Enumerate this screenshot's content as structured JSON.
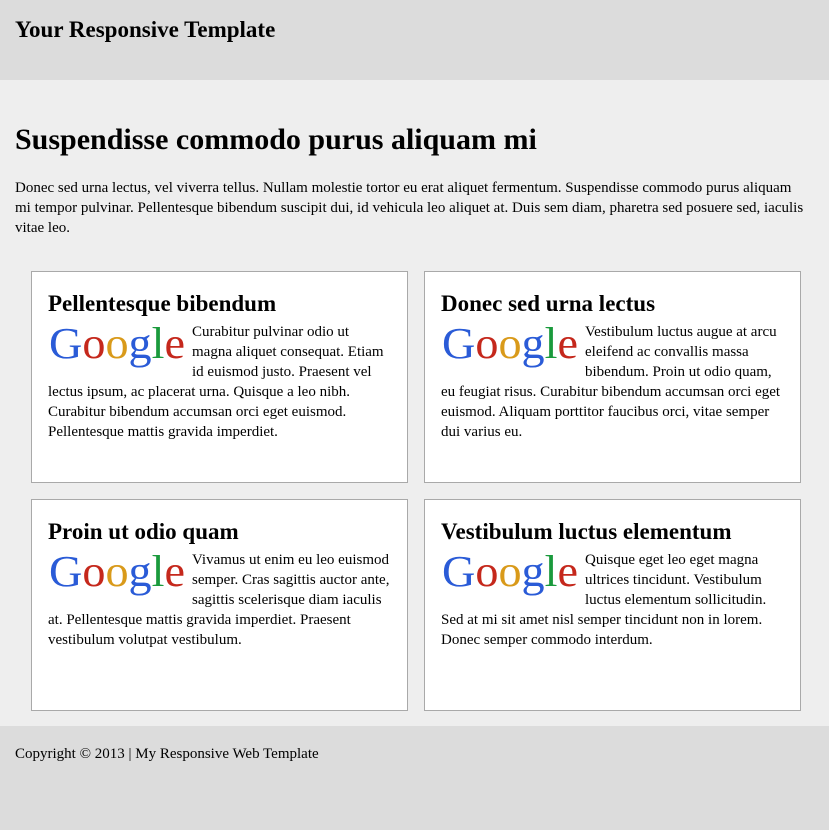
{
  "header": {
    "title": "Your Responsive Template"
  },
  "main": {
    "title": "Suspendisse commodo purus aliquam mi",
    "intro": "Donec sed urna lectus, vel viverra tellus. Nullam molestie tortor eu erat aliquet fermentum. Suspendisse commodo purus aliquam mi tempor pulvinar. Pellentesque bibendum suscipit dui, id vehicula leo aliquet at. Duis sem diam, pharetra sed posuere sed, iaculis vitae leo."
  },
  "cards": [
    {
      "title": "Pellentesque bibendum",
      "logo": "Google",
      "text": "Curabitur pulvinar odio ut magna aliquet consequat. Etiam id euismod justo. Praesent vel lectus ipsum, ac placerat urna. Quisque a leo nibh. Curabitur bibendum accumsan orci eget euismod. Pellentesque mattis gravida imperdiet."
    },
    {
      "title": "Donec sed urna lectus",
      "logo": "Google",
      "text": "Vestibulum luctus augue at arcu eleifend ac convallis massa bibendum. Proin ut odio quam, eu feugiat risus. Curabitur bibendum accumsan orci eget euismod. Aliquam porttitor faucibus orci, vitae semper dui varius eu."
    },
    {
      "title": "Proin ut odio quam",
      "logo": "Google",
      "text": "Vivamus ut enim eu leo euismod semper. Cras sagittis auctor ante, sagittis scelerisque diam iaculis at. Pellentesque mattis gravida imperdiet. Praesent vestibulum volutpat vestibulum."
    },
    {
      "title": "Vestibulum luctus elementum",
      "logo": "Google",
      "text": "Quisque eget leo eget magna ultrices tincidunt. Vestibulum luctus elementum sollicitudin. Sed at mi sit amet nisl semper tincidunt non in lorem. Donec semper commodo interdum."
    }
  ],
  "footer": {
    "text": "Copyright © 2013 | My Responsive Web Template"
  },
  "colors": {
    "header_bg": "#dcdcdc",
    "main_bg": "#eeeeee",
    "card_bg": "#ffffff",
    "card_border": "#a9a9a9",
    "logo_blue": "#2a5bd7",
    "logo_red": "#c5281c",
    "logo_yellow": "#d99a1a",
    "logo_green": "#1a9a3c"
  }
}
